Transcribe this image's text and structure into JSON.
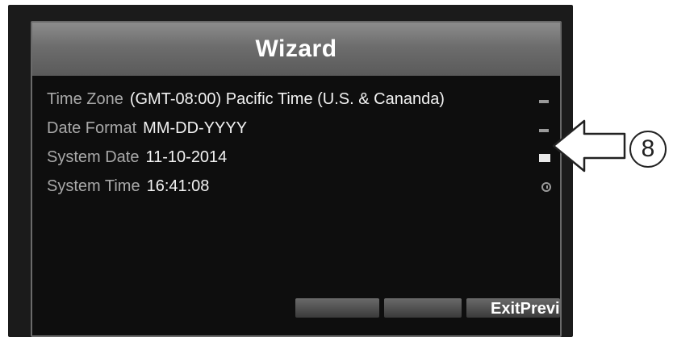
{
  "dialog": {
    "title": "Wizard"
  },
  "fields": [
    {
      "label": "Time Zone",
      "value": "(GMT-08:00) Pacific Time (U.S. & Cananda)",
      "control": "minus-icon"
    },
    {
      "label": "Date Format",
      "value": "MM-DD-YYYY",
      "control": "minus-icon"
    },
    {
      "label": "System Date",
      "value": "11-10-2014",
      "control": "calendar-icon"
    },
    {
      "label": "System Time",
      "value": "16:41:08",
      "control": "clock-icon"
    }
  ],
  "buttons": {
    "exit_preview_label": "ExitPrevi"
  },
  "callout": {
    "number": "8"
  },
  "colors": {
    "title_bar": "#6d6d6d",
    "background": "#0e0e0e",
    "label": "#a9a9a9",
    "value": "#f2f2f2"
  }
}
